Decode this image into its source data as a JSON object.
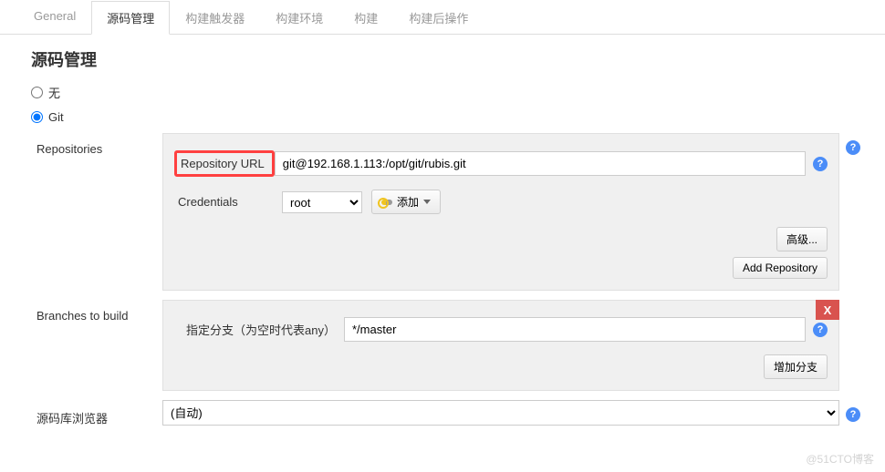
{
  "tabs": {
    "general": "General",
    "scm": "源码管理",
    "triggers": "构建触发器",
    "env": "构建环境",
    "build": "构建",
    "post": "构建后操作"
  },
  "section_title": "源码管理",
  "radios": {
    "none": "无",
    "git": "Git"
  },
  "repositories": {
    "label": "Repositories",
    "repo_url_label": "Repository URL",
    "repo_url_value": "git@192.168.1.113:/opt/git/rubis.git",
    "credentials_label": "Credentials",
    "credentials_value": "root",
    "add_label": "添加",
    "advanced_label": "高级...",
    "add_repo_label": "Add Repository"
  },
  "branches": {
    "label": "Branches to build",
    "branch_spec_label": "指定分支（为空时代表any）",
    "branch_spec_value": "*/master",
    "add_branch_label": "增加分支"
  },
  "browser": {
    "label": "源码库浏览器",
    "value": "(自动)"
  },
  "watermark": "@51CTO博客"
}
